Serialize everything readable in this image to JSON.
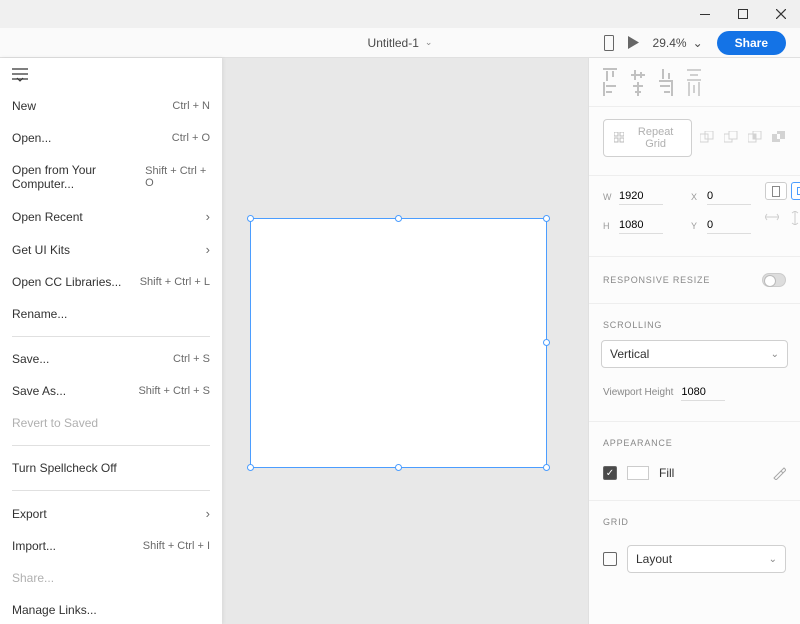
{
  "window": {
    "doc_title": "Untitled-1",
    "zoom": "29.4%",
    "share": "Share"
  },
  "menu": {
    "items": [
      {
        "label": "New",
        "shortcut": "Ctrl + N"
      },
      {
        "label": "Open...",
        "shortcut": "Ctrl + O"
      },
      {
        "label": "Open from Your Computer...",
        "shortcut": "Shift + Ctrl + O"
      },
      {
        "label": "Open Recent",
        "chevron": true
      },
      {
        "label": "Get UI Kits",
        "chevron": true
      },
      {
        "label": "Open CC Libraries...",
        "shortcut": "Shift + Ctrl + L"
      },
      {
        "label": "Rename..."
      },
      {
        "sep": true
      },
      {
        "label": "Save...",
        "shortcut": "Ctrl + S"
      },
      {
        "label": "Save As...",
        "shortcut": "Shift + Ctrl + S"
      },
      {
        "label": "Revert to Saved",
        "disabled": true
      },
      {
        "sep": true
      },
      {
        "label": "Turn Spellcheck Off"
      },
      {
        "sep": true
      },
      {
        "label": "Export",
        "chevron": true
      },
      {
        "label": "Import...",
        "shortcut": "Shift + Ctrl + I"
      },
      {
        "label": "Share...",
        "disabled": true
      },
      {
        "label": "Manage Links..."
      }
    ]
  },
  "inspector": {
    "repeat_grid": "Repeat Grid",
    "w": "1920",
    "x": "0",
    "h": "1080",
    "y": "0",
    "responsive": "Responsive Resize",
    "scrolling": "Scrolling",
    "scroll_value": "Vertical",
    "viewport_label": "Viewport Height",
    "viewport_value": "1080",
    "appearance": "Appearance",
    "fill": "Fill",
    "grid": "Grid",
    "grid_value": "Layout"
  }
}
